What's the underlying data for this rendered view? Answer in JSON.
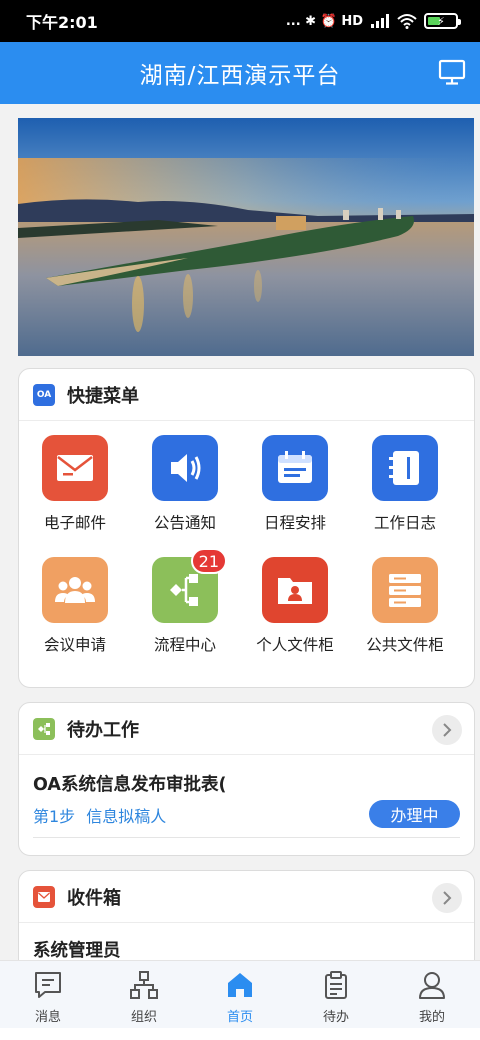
{
  "status_bar": {
    "time": "下午2:01",
    "indicators": "... ✱ ⏰ HD",
    "battery_level": 0.4
  },
  "header": {
    "title": "湖南/江西演示平台",
    "monitor_icon": "monitor-icon"
  },
  "banner": {
    "image": "river-island-sunset-photo"
  },
  "quick_menu": {
    "badge_text": "OA",
    "title": "快捷菜单",
    "items": [
      {
        "label": "电子邮件",
        "icon": "mail-icon",
        "color": "#e5533a"
      },
      {
        "label": "公告通知",
        "icon": "speaker-icon",
        "color": "#2f6fe0"
      },
      {
        "label": "日程安排",
        "icon": "calendar-icon",
        "color": "#2f6fe0"
      },
      {
        "label": "工作日志",
        "icon": "notebook-icon",
        "color": "#2f6fe0"
      },
      {
        "label": "会议申请",
        "icon": "group-icon",
        "color": "#f0a062"
      },
      {
        "label": "流程中心",
        "icon": "flow-icon",
        "color": "#8cbf5a",
        "badge": "21"
      },
      {
        "label": "个人文件柜",
        "icon": "person-folder-icon",
        "color": "#e0452f"
      },
      {
        "label": "公共文件柜",
        "icon": "server-icon",
        "color": "#f0a062"
      }
    ]
  },
  "todo": {
    "title": "待办工作",
    "icon_color": "#8cbf5a",
    "item": {
      "title": "OA系统信息发布审批表(",
      "step": "第1步 信息拟稿人",
      "status": "办理中"
    }
  },
  "inbox": {
    "title": "收件箱",
    "icon_color": "#e5533a",
    "item": {
      "sender": "系统管理员"
    }
  },
  "tabs": [
    {
      "label": "消息",
      "icon": "message-icon",
      "active": false
    },
    {
      "label": "组织",
      "icon": "org-icon",
      "active": false
    },
    {
      "label": "首页",
      "icon": "home-icon",
      "active": true
    },
    {
      "label": "待办",
      "icon": "clipboard-icon",
      "active": false
    },
    {
      "label": "我的",
      "icon": "user-icon",
      "active": false
    }
  ],
  "colors": {
    "primary": "#2b8df0",
    "status_pill": "#3a7fe8",
    "badge": "#e53935",
    "link": "#2e86de"
  }
}
